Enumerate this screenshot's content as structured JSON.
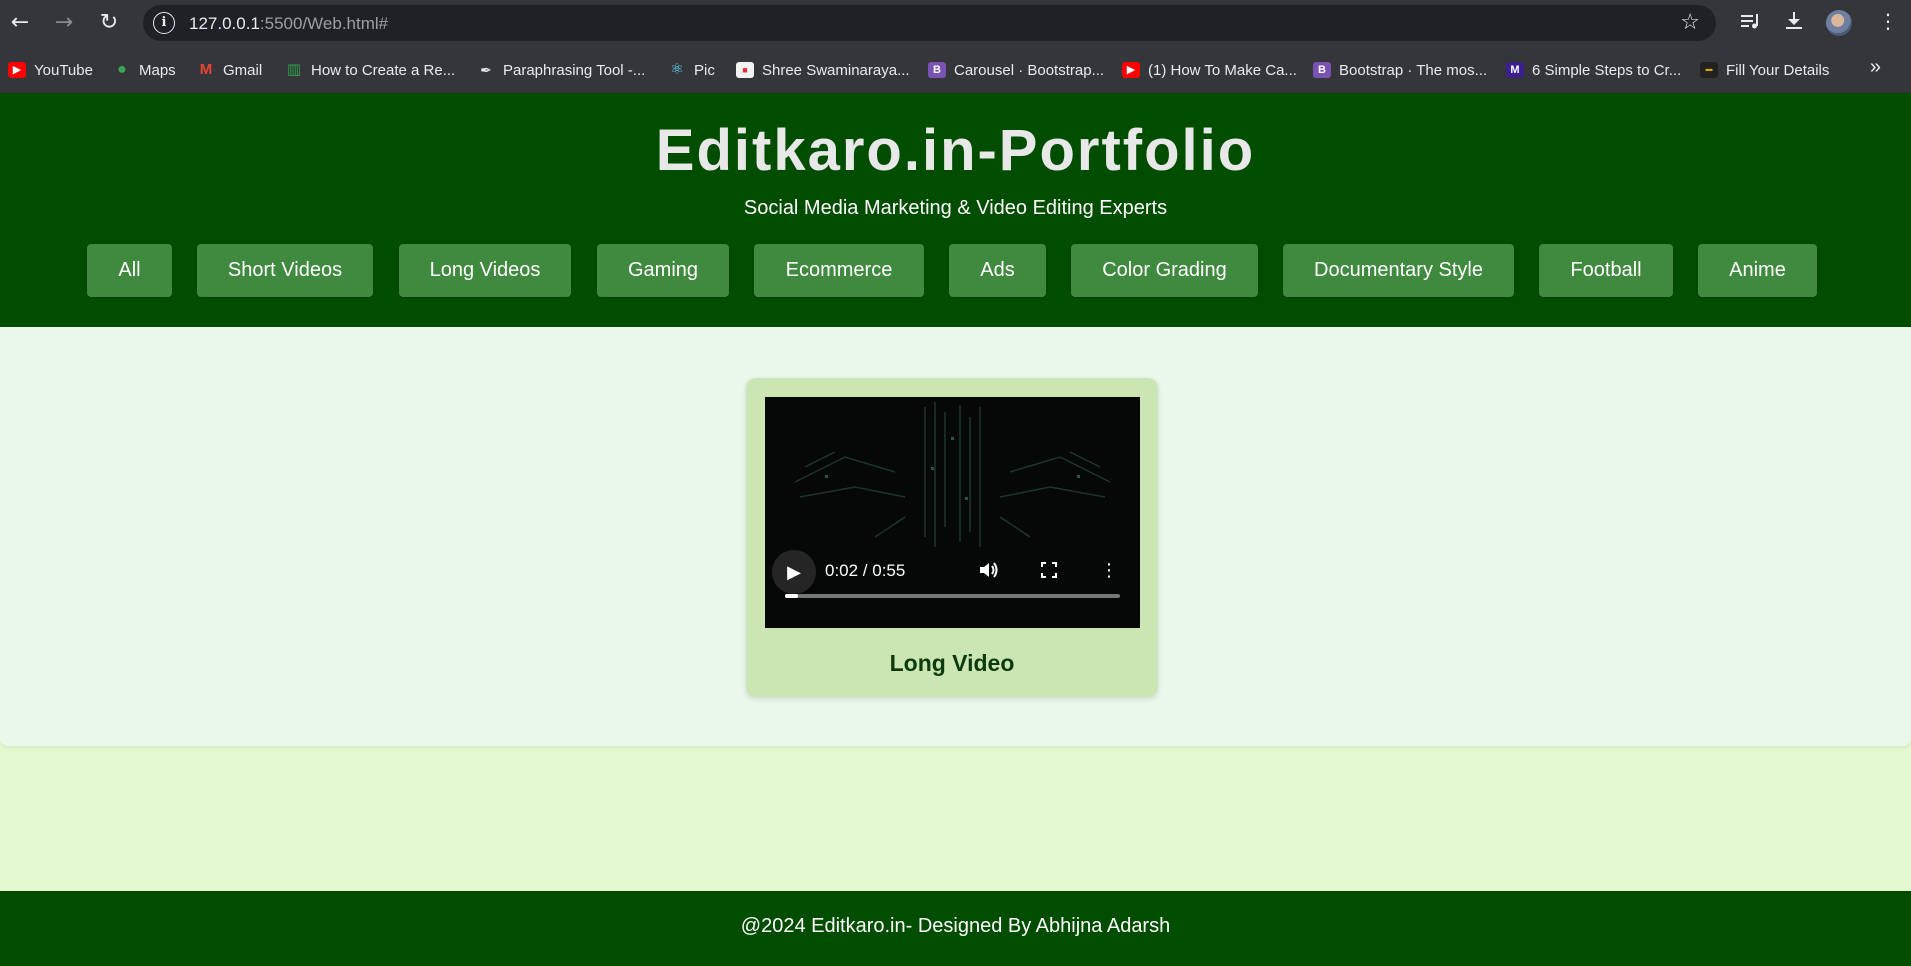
{
  "browser": {
    "url_host": "127.0.0.1",
    "url_rest": ":5500/Web.html#",
    "bookmarks": [
      {
        "label": "YouTube",
        "icon": "youtube-icon",
        "color": "#ff0000"
      },
      {
        "label": "Maps",
        "icon": "maps-icon",
        "color": "#34a853"
      },
      {
        "label": "Gmail",
        "icon": "gmail-icon",
        "color": "#ea4335"
      },
      {
        "label": "How to Create a Re...",
        "icon": "bookmark-site-icon",
        "color": "#2ea44f"
      },
      {
        "label": "Paraphrasing Tool -...",
        "icon": "quill-icon",
        "color": "#9aa0a6"
      },
      {
        "label": "Pic",
        "icon": "react-icon",
        "color": "#61dafb"
      },
      {
        "label": "Shree Swaminaraya...",
        "icon": "temple-icon",
        "color": "#e8eaed"
      },
      {
        "label": "Carousel · Bootstrap...",
        "icon": "bootstrap-icon",
        "color": "#7952b3"
      },
      {
        "label": "(1) How To Make Ca...",
        "icon": "youtube-icon",
        "color": "#ff0000"
      },
      {
        "label": "Bootstrap · The mos...",
        "icon": "bootstrap-icon",
        "color": "#7952b3"
      },
      {
        "label": "6 Simple Steps to Cr...",
        "icon": "medium-icon",
        "color": "#5a2fc2"
      },
      {
        "label": "Fill Your Details",
        "icon": "site-icon",
        "color": "#e6a000"
      }
    ]
  },
  "header": {
    "title": "Editkaro.in-Portfolio",
    "tagline": "Social Media Marketing & Video Editing Experts",
    "filters": [
      "All",
      "Short Videos",
      "Long Videos",
      "Gaming",
      "Ecommerce",
      "Ads",
      "Color Grading",
      "Documentary Style",
      "Football",
      "Anime"
    ]
  },
  "gallery": {
    "items": [
      {
        "title": "Long Video",
        "video": {
          "current_time": "0:02",
          "duration": "0:55",
          "time_display": "0:02 / 0:55",
          "progress": 0.04
        }
      }
    ]
  },
  "footer": {
    "text": "@2024 Editkaro.in- Designed By Abhijna Adarsh"
  },
  "colors": {
    "header_bg": "#004d00",
    "button_bg": "#3f8a3f",
    "card_bg": "#cbe6b2",
    "gallery_bg": "#eaf8ec",
    "page_bg": "#e4f9cf"
  }
}
